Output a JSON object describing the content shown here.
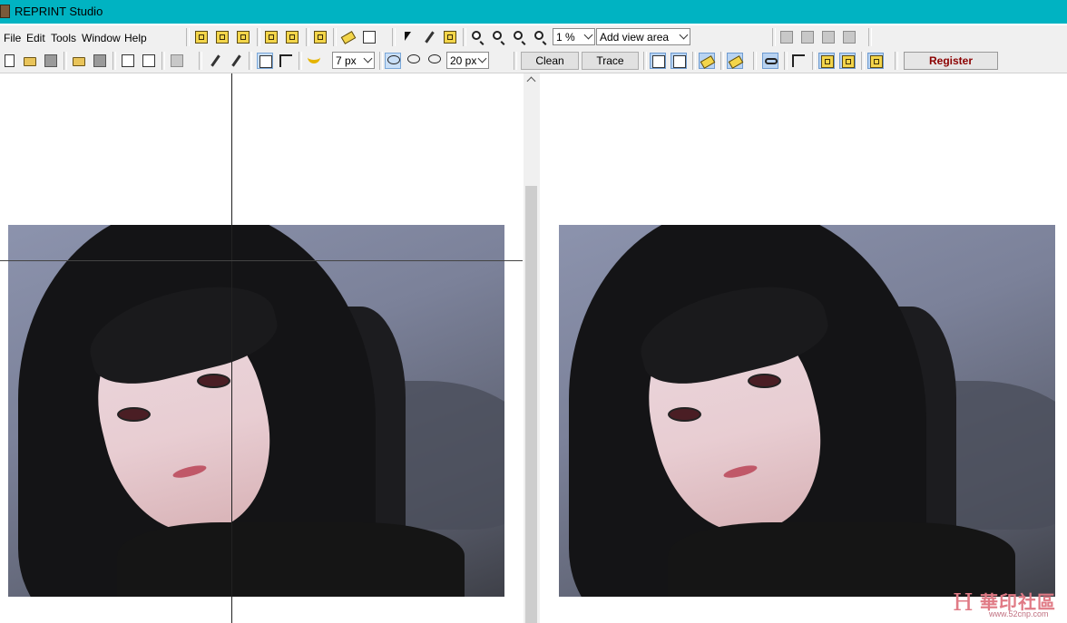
{
  "window": {
    "title": "REPRINT Studio"
  },
  "menu": {
    "items": [
      "File",
      "Edit",
      "Tools",
      "Window",
      "Help"
    ]
  },
  "toolbar": {
    "zoom_value": "1 %",
    "view_mode": "Add view area",
    "brush_size": "7 px",
    "tolerance": "20 px",
    "clean_label": "Clean",
    "trace_label": "Trace",
    "register_label": "Register"
  },
  "watermark": {
    "logo": "H",
    "text": "華印社區",
    "url": "www.52cnp.com"
  },
  "colors": {
    "titlebar": "#00b3c2",
    "toolbar": "#f0f0f0",
    "register_text": "#8b0000"
  }
}
